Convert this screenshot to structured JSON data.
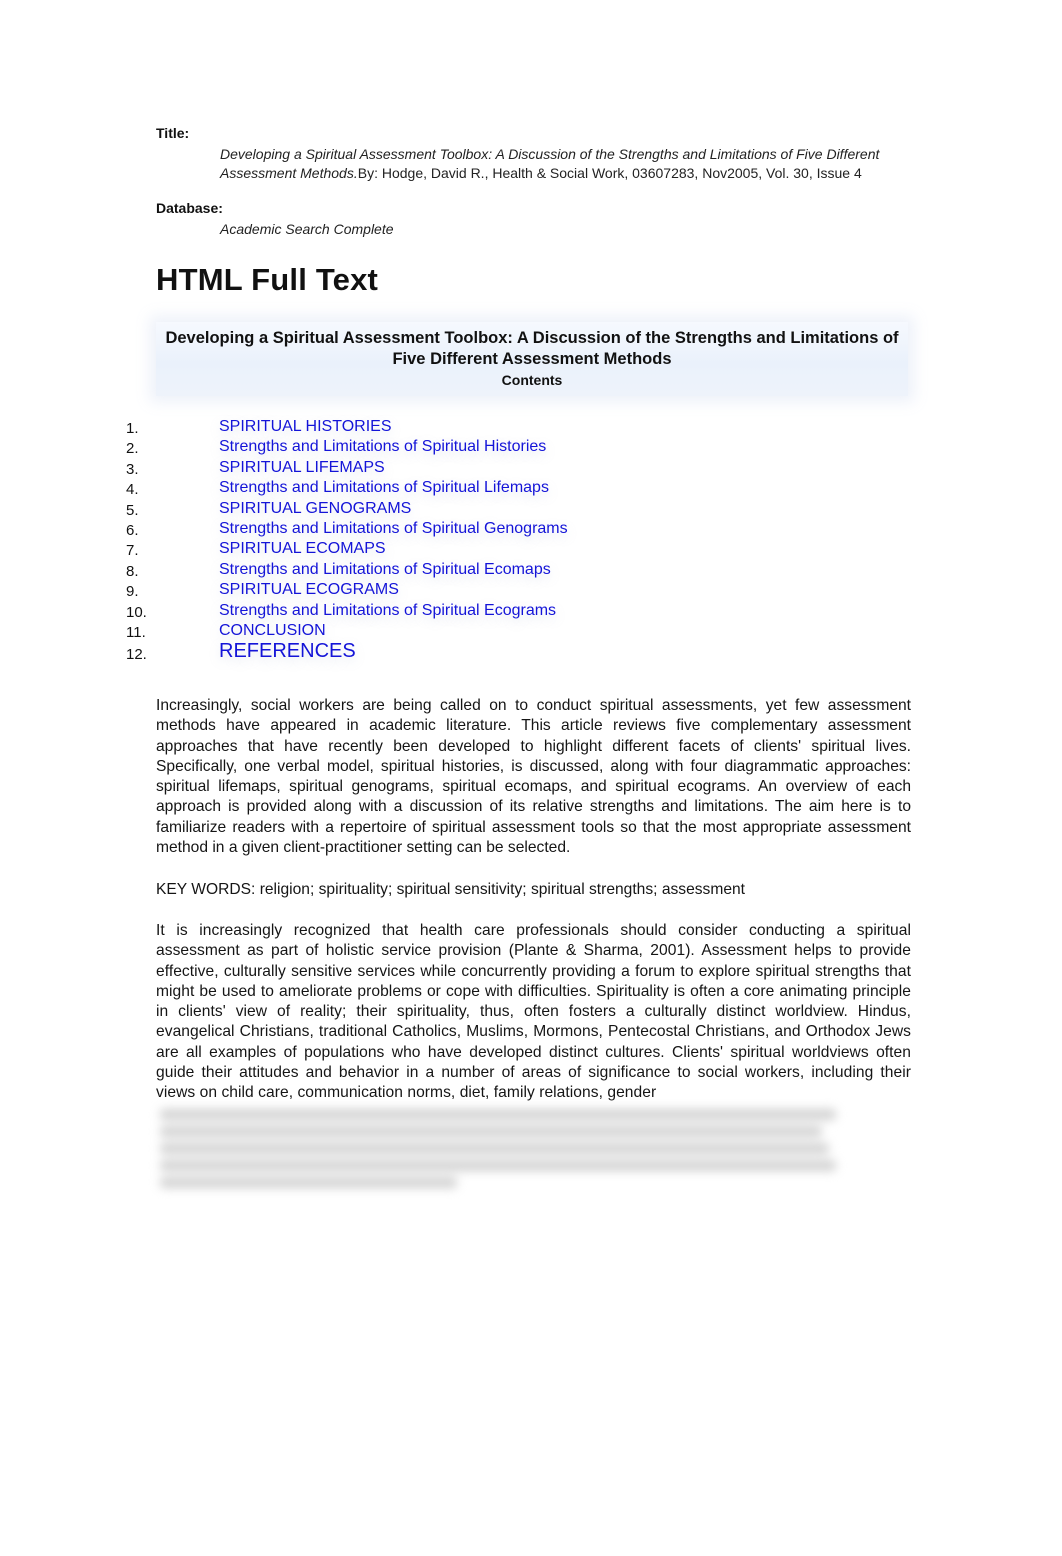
{
  "citation": {
    "title_label": "Title:",
    "title_italic": "Developing a Spiritual Assessment Toolbox: A Discussion of the Strengths and Limitations of Five Different Assessment Methods.",
    "title_rest": "By: Hodge, David R., Health & Social Work, 03607283, Nov2005, Vol. 30, Issue 4",
    "database_label": "Database:",
    "database_value": "Academic Search Complete"
  },
  "heading": "HTML Full Text",
  "toc": {
    "article_title": "Developing a Spiritual Assessment Toolbox: A Discussion of the Strengths and Limitations of Five Different Assessment Methods",
    "contents_label": "Contents",
    "items": [
      {
        "number": "1.",
        "label": "SPIRITUAL HISTORIES"
      },
      {
        "number": "2.",
        "label": "Strengths and Limitations of Spiritual Histories"
      },
      {
        "number": "3.",
        "label": "SPIRITUAL LIFEMAPS"
      },
      {
        "number": "4.",
        "label": "Strengths and Limitations of Spiritual Lifemaps"
      },
      {
        "number": "5.",
        "label": "SPIRITUAL GENOGRAMS"
      },
      {
        "number": "6.",
        "label": "Strengths and Limitations of Spiritual Genograms"
      },
      {
        "number": "7.",
        "label": "SPIRITUAL ECOMAPS"
      },
      {
        "number": "8.",
        "label": "Strengths and Limitations of Spiritual Ecomaps"
      },
      {
        "number": "9.",
        "label": "SPIRITUAL ECOGRAMS"
      },
      {
        "number": "10.",
        "label": "Strengths and Limitations of Spiritual Ecograms"
      },
      {
        "number": "11.",
        "label": "CONCLUSION"
      },
      {
        "number": "12.",
        "label": "REFERENCES"
      }
    ]
  },
  "abstract": "Increasingly, social workers are being called on to conduct spiritual assessments, yet few assessment methods have appeared in academic literature. This article reviews five complementary assessment approaches that have recently been developed to highlight different facets of clients' spiritual lives. Specifically, one verbal model, spiritual histories, is discussed, along with four diagrammatic approaches: spiritual lifemaps, spiritual genograms, spiritual ecomaps, and spiritual ecograms. An overview of each approach is provided along with a discussion of its relative strengths and limitations. The aim here is to familiarize readers with a repertoire of spiritual assessment tools so that the most appropriate assessment method in a given client-practitioner setting can be selected.",
  "keywords": "KEY WORDS: religion; spirituality; spiritual sensitivity; spiritual strengths; assessment",
  "intro": "It is increasingly recognized that health care professionals should consider conducting a spiritual assessment as part of holistic service provision (Plante & Sharma, 2001). Assessment helps to provide effective, culturally sensitive services while concurrently providing a forum to explore spiritual strengths that might be used to ameliorate problems or cope with difficulties. Spirituality is often a core animating principle in clients' view of reality; their spirituality, thus, often fosters a culturally distinct worldview. Hindus, evangelical Christians, traditional Catholics, Muslims, Mormons, Pentecostal Christians, and Orthodox Jews are all examples of populations who have developed distinct cultures. Clients' spiritual worldviews often guide their attitudes and behavior in a number of areas of significance to social workers, including their views on child care, communication norms, diet, family relations, gender"
}
